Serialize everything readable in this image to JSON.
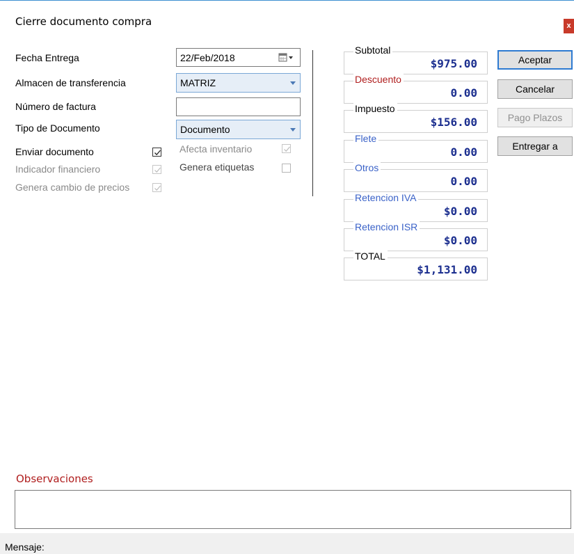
{
  "window": {
    "title": "Cierre documento compra",
    "close_label": "x"
  },
  "form": {
    "fecha_label": "Fecha Entrega",
    "fecha_value": "22/Feb/2018",
    "almacen_label": "Almacen de transferencia",
    "almacen_value": "MATRIZ",
    "factura_label": "Número de factura",
    "factura_value": "",
    "tipo_label": "Tipo de Documento",
    "tipo_value": "Documento"
  },
  "checks": {
    "enviar": {
      "label": "Enviar documento",
      "checked": true,
      "enabled": true
    },
    "indicador": {
      "label": "Indicador financiero",
      "checked": true,
      "enabled": false
    },
    "genera_cambio": {
      "label": "Genera cambio de precios",
      "checked": true,
      "enabled": false
    },
    "afecta": {
      "label": "Afecta inventario",
      "checked": true,
      "enabled": false
    },
    "etiquetas": {
      "label": "Genera etiquetas",
      "checked": false,
      "enabled": true
    }
  },
  "totals": {
    "subtotal": {
      "label": "Subtotal",
      "value": "$975.00",
      "label_color": "#000000"
    },
    "descuento": {
      "label": "Descuento",
      "value": "0.00",
      "label_color": "#b01e1e"
    },
    "impuesto": {
      "label": "Impuesto",
      "value": "$156.00",
      "label_color": "#000000"
    },
    "flete": {
      "label": "Flete",
      "value": "0.00",
      "label_color": "#3a62c8"
    },
    "otros": {
      "label": "Otros",
      "value": "0.00",
      "label_color": "#3a62c8"
    },
    "ret_iva": {
      "label": "Retencion IVA",
      "value": "$0.00",
      "label_color": "#3a62c8"
    },
    "ret_isr": {
      "label": "Retencion ISR",
      "value": "$0.00",
      "label_color": "#3a62c8"
    },
    "total": {
      "label": "TOTAL",
      "value": "$1,131.00",
      "label_color": "#000000"
    }
  },
  "buttons": {
    "aceptar": "Aceptar",
    "cancelar": "Cancelar",
    "pago_plazos": "Pago Plazos",
    "entregar": "Entregar a"
  },
  "observaciones": {
    "label": "Observaciones",
    "value": ""
  },
  "status": {
    "mensaje": "Mensaje:"
  }
}
